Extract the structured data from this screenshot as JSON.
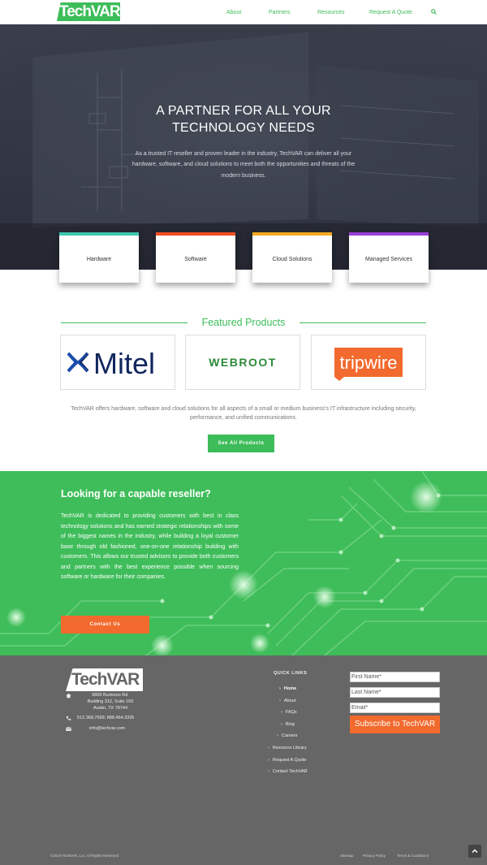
{
  "header": {
    "logo_text": "TechVAR",
    "nav": [
      {
        "label": "About"
      },
      {
        "label": "Partners"
      },
      {
        "label": "Resources"
      },
      {
        "label": "Request A Quote"
      }
    ],
    "search_icon": "search-icon"
  },
  "hero": {
    "title_line1": "A PARTNER FOR ALL YOUR",
    "title_line2": "TECHNOLOGY NEEDS",
    "text": "As a trusted IT reseller and proven leader in the industry, TechVAR can deliver all your hardware, software, and cloud solutions to meet both the opportunities and threats of the modern business."
  },
  "services": [
    {
      "label": "Hardware",
      "color": "#3ec6b0"
    },
    {
      "label": "Software",
      "color": "#f04e23"
    },
    {
      "label": "Cloud Solutions",
      "color": "#f7a823"
    },
    {
      "label": "Managed Services",
      "color": "#9b3fd4"
    }
  ],
  "featured": {
    "title": "Featured Products",
    "products": [
      {
        "name": "Mitel",
        "color": "#11265e",
        "accent": "#1a4dab"
      },
      {
        "name": "WEBROOT",
        "color": "#2f8a3a"
      },
      {
        "name": "tripwire",
        "color": "#ffffff",
        "bg": "#f26a2e"
      }
    ],
    "description": "TechVAR offers hardware, software and cloud solutions for all aspects of a small or medium business's IT infrastructure including security, performance, and unified communications.",
    "button": "See All Products"
  },
  "reseller": {
    "title": "Looking for a capable reseller?",
    "text": "TechVAR is dedicated to providing customers with best in class technology solutions and has earned strategic relationships with some of the biggest names in the industry, while building a loyal customer base through old fashioned, one-on-one relationship building with customers. This allows our trusted advisors to provide both customers and partners with the best experience possible when sourcing software or hardware for their companies.",
    "button": "Contact Us"
  },
  "footer": {
    "logo_text": "TechVAR",
    "address_lines": [
      "6800 Burleson Rd.",
      "Building 312, Suite 150",
      "Austin, TX 78744"
    ],
    "phone": "512.368.7699; 888.464.3335",
    "email": "info@techvar.com",
    "quick_links_title": "QUICK LINKS",
    "quick_links": [
      "Home",
      "About",
      "FAQs",
      "Blog",
      "Careers",
      "Resource Library",
      "Request A Quote",
      "Contact TechVAR"
    ],
    "form": {
      "first_name_placeholder": "First Name*",
      "last_name_placeholder": "Last Name*",
      "email_placeholder": "Email*",
      "submit": "Subscribe to TechVAR"
    },
    "copyright": "©2018 TechVAR, LLC All Rights Reserved",
    "bottom_links": [
      "Sitemap",
      "Privacy Policy",
      "Terms & Conditions"
    ]
  }
}
